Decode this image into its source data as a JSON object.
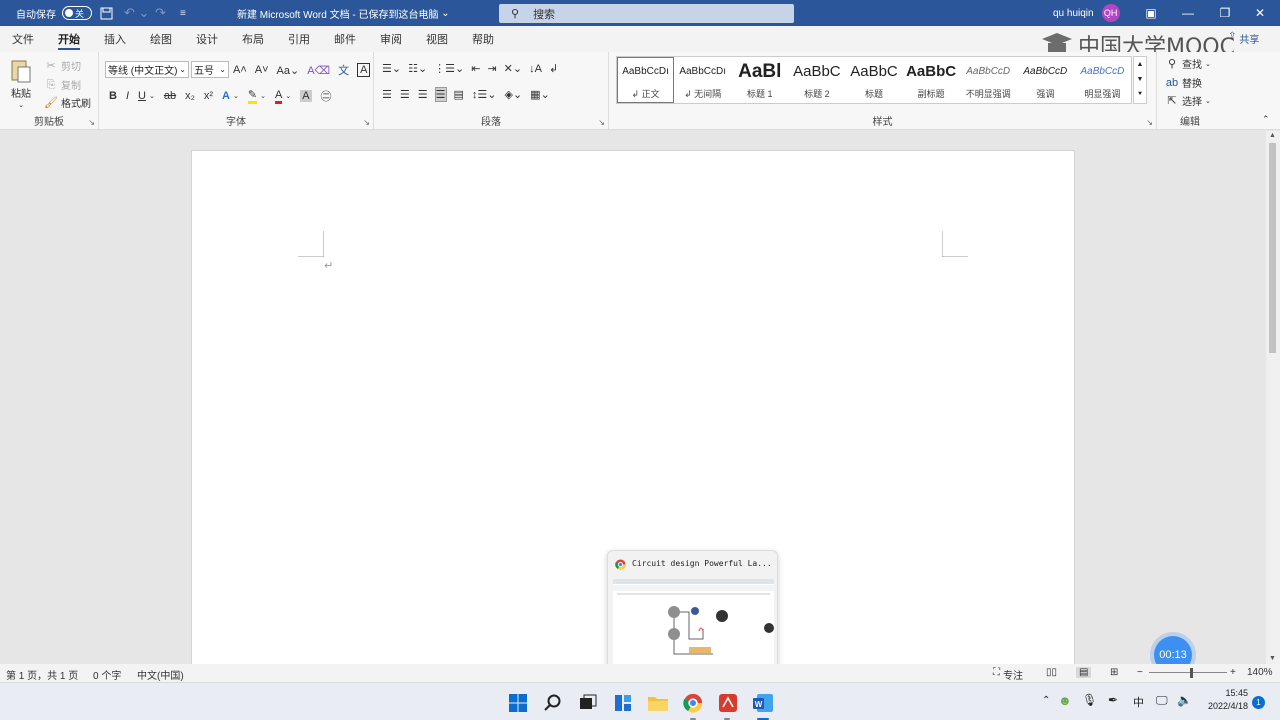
{
  "titlebar": {
    "autosave_label": "自动保存",
    "autosave_state": "关",
    "doc_title": "新建 Microsoft Word 文档 - 已保存到这台电脑",
    "search_placeholder": "搜索",
    "user_name": "qu huiqin",
    "user_initials": "QH"
  },
  "tabs": [
    "文件",
    "开始",
    "插入",
    "绘图",
    "设计",
    "布局",
    "引用",
    "邮件",
    "审阅",
    "视图",
    "帮助"
  ],
  "share_label": "共享",
  "watermark": "中国大学MOOC",
  "ribbon": {
    "clipboard": {
      "paste": "粘贴",
      "cut": "剪切",
      "copy": "复制",
      "format_painter": "格式刷",
      "label": "剪贴板"
    },
    "font": {
      "name": "等线 (中文正文)",
      "size": "五号",
      "label": "字体"
    },
    "paragraph": {
      "label": "段落"
    },
    "styles": {
      "label": "样式",
      "items": [
        {
          "preview": "AaBbCcDı",
          "name": "↲ 正文"
        },
        {
          "preview": "AaBbCcDı",
          "name": "↲ 无间隔"
        },
        {
          "preview": "AaBl",
          "name": "标题 1"
        },
        {
          "preview": "AaBbC",
          "name": "标题 2"
        },
        {
          "preview": "AaBbC",
          "name": "标题"
        },
        {
          "preview": "AaBbC",
          "name": "副标题"
        },
        {
          "preview": "AaBbCcD",
          "name": "不明显强调"
        },
        {
          "preview": "AaBbCcD",
          "name": "强调"
        },
        {
          "preview": "AaBbCcD",
          "name": "明显强调"
        }
      ]
    },
    "editing": {
      "find": "查找",
      "replace": "替换",
      "select": "选择",
      "label": "编辑"
    }
  },
  "document": {
    "paragraph_mark": "↵"
  },
  "status": {
    "page": "第 1 页，共 1 页",
    "words": "0 个字",
    "language": "中文(中国)",
    "focus": "专注",
    "zoom": "140%"
  },
  "preview": {
    "title": "Circuit design Powerful La..."
  },
  "timer": "00:13",
  "tray": {
    "ime": "中",
    "time": "15:45",
    "date": "2022/4/18",
    "badge": "1"
  }
}
